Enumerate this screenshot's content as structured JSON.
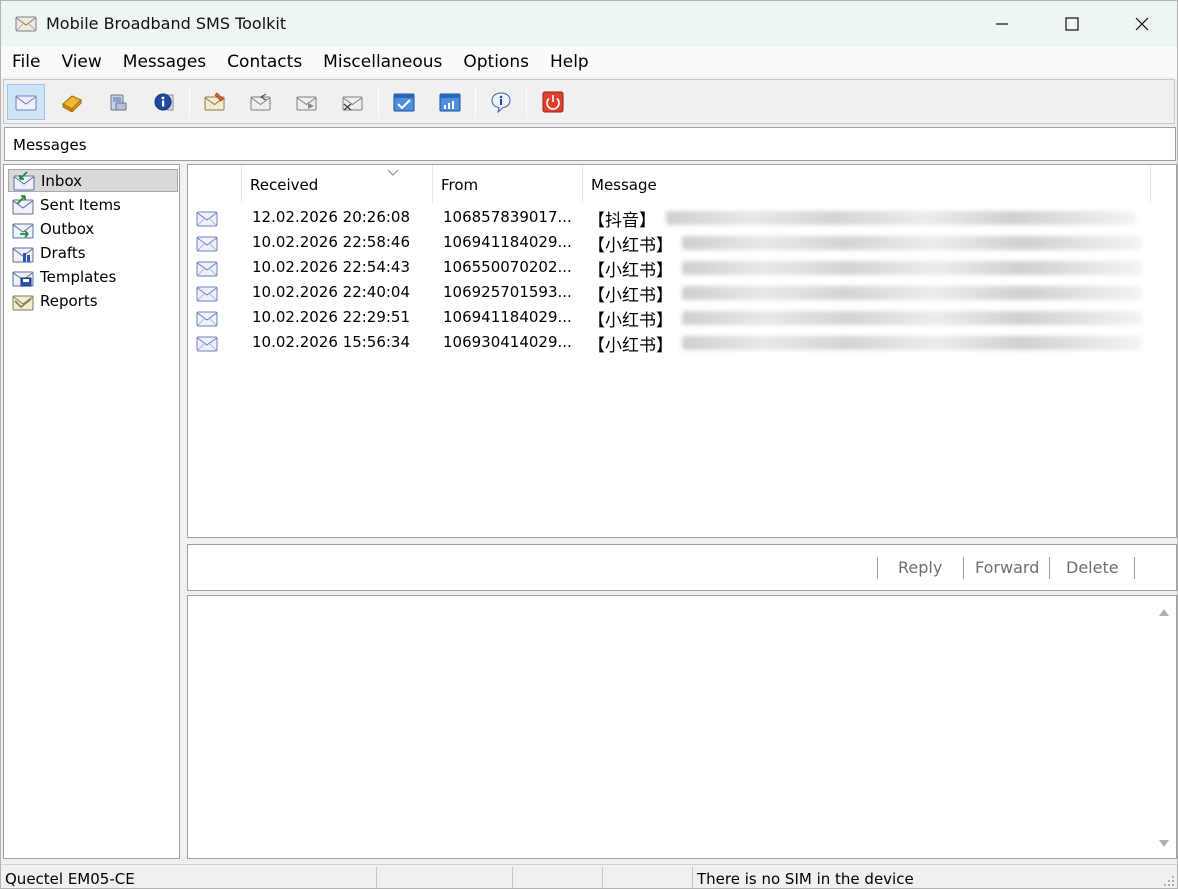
{
  "window": {
    "title": "Mobile Broadband SMS Toolkit",
    "accent_color": "#cde3f6"
  },
  "menu": {
    "items": [
      "File",
      "View",
      "Messages",
      "Contacts",
      "Miscellaneous",
      "Options",
      "Help"
    ]
  },
  "toolbar": {
    "buttons": [
      {
        "icon": "envelope-icon",
        "pressed": true
      },
      {
        "icon": "contacts-book-icon"
      },
      {
        "icon": "device-icon"
      },
      {
        "icon": "info-circle-icon"
      },
      {
        "icon": "new-message-icon"
      },
      {
        "icon": "reply-message-icon"
      },
      {
        "icon": "forward-message-icon"
      },
      {
        "icon": "delete-message-icon"
      },
      {
        "icon": "check-window-icon"
      },
      {
        "icon": "signal-window-icon"
      },
      {
        "icon": "help-balloon-icon"
      },
      {
        "icon": "power-icon"
      }
    ]
  },
  "section": {
    "title": "Messages"
  },
  "folders": {
    "items": [
      {
        "label": "Inbox",
        "selected": true
      },
      {
        "label": "Sent Items"
      },
      {
        "label": "Outbox"
      },
      {
        "label": "Drafts"
      },
      {
        "label": "Templates"
      },
      {
        "label": "Reports"
      }
    ]
  },
  "message_list": {
    "columns": {
      "received": "Received",
      "from": "From",
      "message": "Message"
    },
    "sorted_by": "received",
    "rows": [
      {
        "received": "12.02.2026 20:26:08",
        "from": "106857839017...",
        "message_prefix": "【抖音】"
      },
      {
        "received": "10.02.2026 22:58:46",
        "from": "106941184029...",
        "message_prefix": "【小红书】"
      },
      {
        "received": "10.02.2026 22:54:43",
        "from": "106550070202...",
        "message_prefix": "【小红书】"
      },
      {
        "received": "10.02.2026 22:40:04",
        "from": "106925701593...",
        "message_prefix": "【小红书】"
      },
      {
        "received": "10.02.2026 22:29:51",
        "from": "106941184029...",
        "message_prefix": "【小红书】"
      },
      {
        "received": "10.02.2026 15:56:34",
        "from": "106930414029...",
        "message_prefix": "【小红书】"
      }
    ]
  },
  "actions": {
    "reply": "Reply",
    "forward": "Forward",
    "delete": "Delete"
  },
  "status": {
    "device": "Quectel EM05-CE",
    "cell2": "",
    "cell3": "",
    "cell4": "",
    "sim": "There is no SIM in the device"
  }
}
